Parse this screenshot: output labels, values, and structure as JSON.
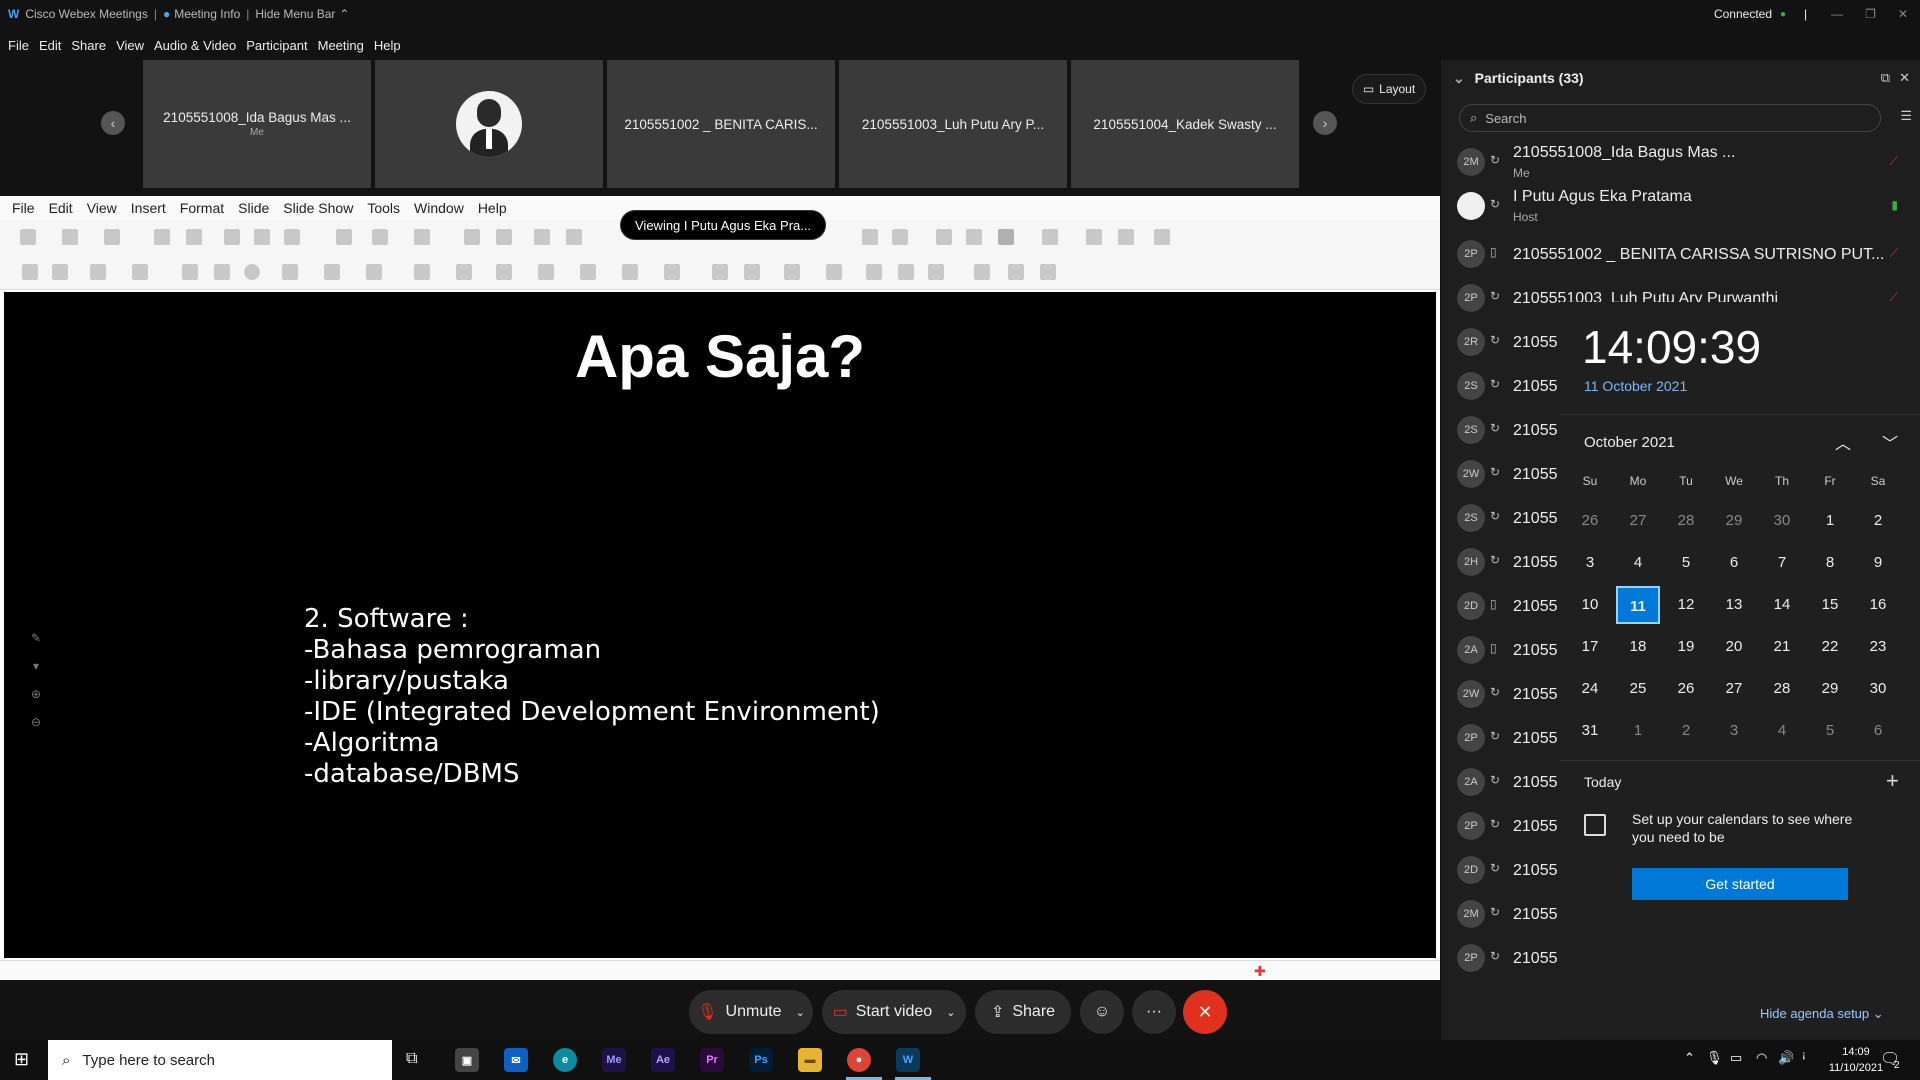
{
  "titlebar": {
    "app": "Cisco Webex Meetings",
    "info": "Meeting Info",
    "hide": "Hide Menu Bar",
    "status": "Connected"
  },
  "menu": [
    "File",
    "Edit",
    "Share",
    "View",
    "Audio & Video",
    "Participant",
    "Meeting",
    "Help"
  ],
  "thumbs": [
    "2105551008_Ida Bagus Mas ...",
    "",
    "2105551002 _ BENITA CARIS...",
    "2105551003_Luh Putu Ary P...",
    "2105551004_Kadek Swasty ..."
  ],
  "thumb_me": "Me",
  "layout_label": "Layout",
  "viewing": "Viewing I Putu Agus Eka Pra...",
  "app_menu": [
    "File",
    "Edit",
    "View",
    "Insert",
    "Format",
    "Slide",
    "Slide Show",
    "Tools",
    "Window",
    "Help"
  ],
  "slide": {
    "title": "Apa Saja?",
    "lines": [
      "2. Software :",
      "-Bahasa pemrograman",
      "-library/pustaka",
      "-IDE (Integrated Development Environment)",
      "-Algoritma",
      "-database/DBMS"
    ]
  },
  "controls": {
    "unmute": "Unmute",
    "start_video": "Start video",
    "share": "Share"
  },
  "participants": {
    "header": "Participants (33)",
    "search_placeholder": "Search",
    "rows": [
      {
        "initials": "2M",
        "name": "2105551008_Ida Bagus Mas ...",
        "sub": "Me"
      },
      {
        "initials": "",
        "name": "I Putu Agus Eka Pratama",
        "sub": "Host"
      },
      {
        "initials": "2P",
        "name": "2105551002 _ BENITA CARISSA SUTRISNO PUT...",
        "sub": ""
      },
      {
        "initials": "2P",
        "name": "2105551003_Luh Putu Ary Purwanthi",
        "sub": ""
      },
      {
        "initials": "2R",
        "name": "21055",
        "sub": ""
      },
      {
        "initials": "2S",
        "name": "21055",
        "sub": ""
      },
      {
        "initials": "2S",
        "name": "21055",
        "sub": ""
      },
      {
        "initials": "2W",
        "name": "21055",
        "sub": ""
      },
      {
        "initials": "2S",
        "name": "21055",
        "sub": ""
      },
      {
        "initials": "2H",
        "name": "21055",
        "sub": ""
      },
      {
        "initials": "2D",
        "name": "21055",
        "sub": ""
      },
      {
        "initials": "2A",
        "name": "21055",
        "sub": ""
      },
      {
        "initials": "2W",
        "name": "21055",
        "sub": ""
      },
      {
        "initials": "2P",
        "name": "21055",
        "sub": ""
      },
      {
        "initials": "2A",
        "name": "21055",
        "sub": ""
      },
      {
        "initials": "2P",
        "name": "21055",
        "sub": ""
      },
      {
        "initials": "2D",
        "name": "21055",
        "sub": ""
      },
      {
        "initials": "2M",
        "name": "21055",
        "sub": ""
      },
      {
        "initials": "2P",
        "name": "21055",
        "sub": ""
      }
    ]
  },
  "calendar": {
    "time": "14:09:39",
    "date": "11 October 2021",
    "month": "October 2021",
    "dow": [
      "Su",
      "Mo",
      "Tu",
      "We",
      "Th",
      "Fr",
      "Sa"
    ],
    "weeks": [
      [
        "26",
        "27",
        "28",
        "29",
        "30",
        "1",
        "2"
      ],
      [
        "3",
        "4",
        "5",
        "6",
        "7",
        "8",
        "9"
      ],
      [
        "10",
        "11",
        "12",
        "13",
        "14",
        "15",
        "16"
      ],
      [
        "17",
        "18",
        "19",
        "20",
        "21",
        "22",
        "23"
      ],
      [
        "24",
        "25",
        "26",
        "27",
        "28",
        "29",
        "30"
      ],
      [
        "31",
        "1",
        "2",
        "3",
        "4",
        "5",
        "6"
      ]
    ],
    "selected": "11",
    "today": "Today",
    "setup_text": "Set up your calendars to see where you need to be",
    "get_started": "Get started",
    "hide_agenda": "Hide agenda setup"
  },
  "taskbar": {
    "search": "Type here to search",
    "time": "14:09",
    "date": "11/10/2021",
    "badge": "2"
  },
  "colors": {
    "accent": "#0078d7",
    "leave": "#e0311f",
    "mic_off": "#d9332b",
    "mic_on": "#2fb24c"
  }
}
